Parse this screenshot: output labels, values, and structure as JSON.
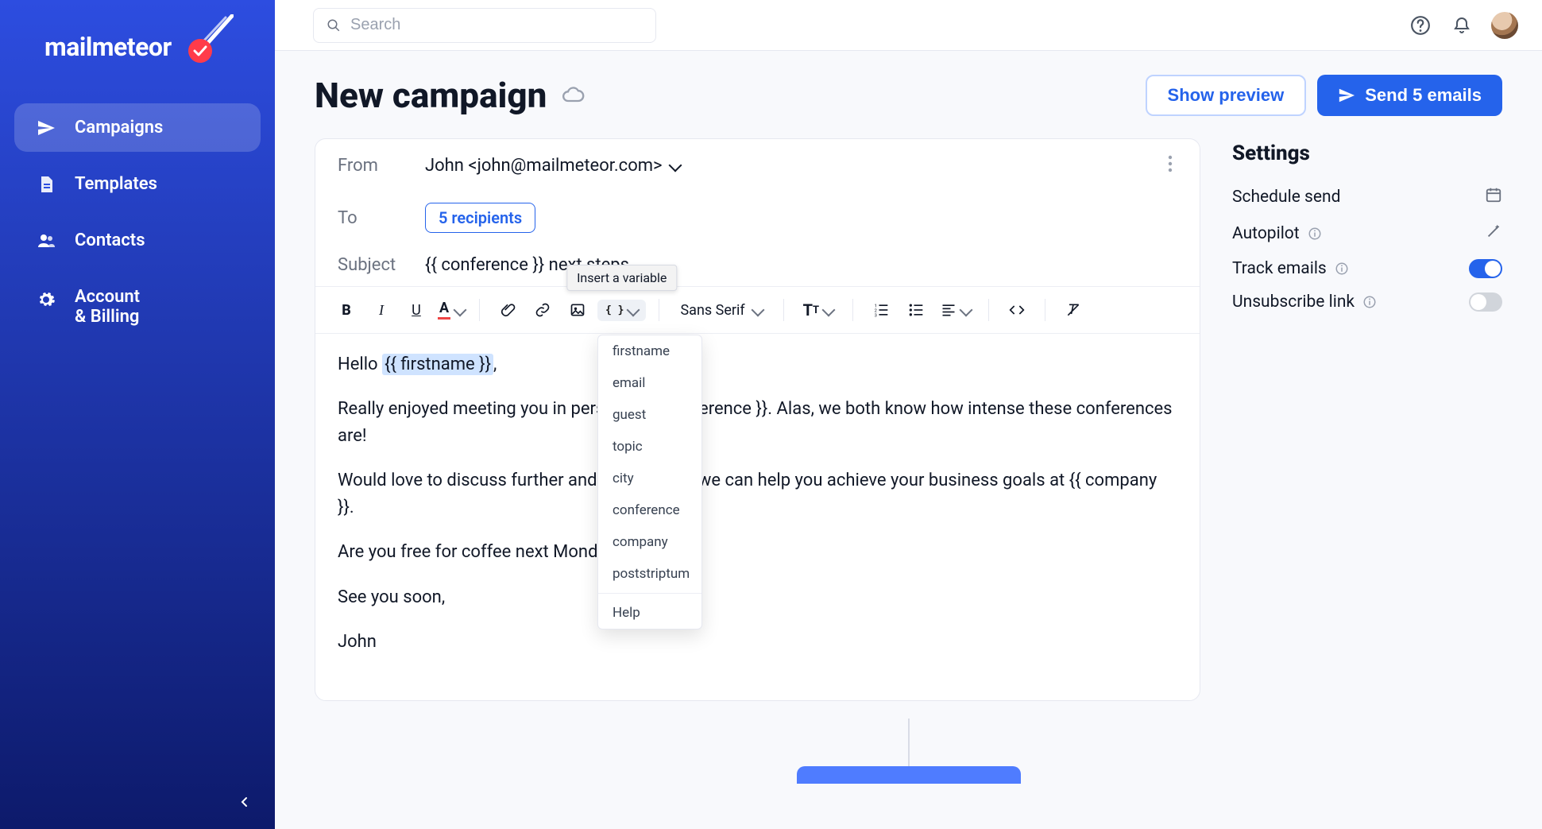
{
  "brand": {
    "name": "mailmeteor"
  },
  "sidebar": {
    "items": [
      {
        "label": "Campaigns",
        "icon": "send-icon",
        "active": true
      },
      {
        "label": "Templates",
        "icon": "file-icon",
        "active": false
      },
      {
        "label": "Contacts",
        "icon": "people-icon",
        "active": false
      },
      {
        "label": "Account & Billing",
        "icon": "gear-icon",
        "active": false
      }
    ]
  },
  "topbar": {
    "search_placeholder": "Search"
  },
  "page": {
    "title": "New campaign",
    "preview_btn": "Show preview",
    "send_btn": "Send 5 emails"
  },
  "compose": {
    "from_label": "From",
    "from_value": "John <john@mailmeteor.com>",
    "to_label": "To",
    "recipients": "5 recipients",
    "subject_label": "Subject",
    "subject_value": "{{ conference }} next steps"
  },
  "toolbar": {
    "font": "Sans Serif",
    "variable_tooltip": "Insert a variable",
    "variable_items": [
      "firstname",
      "email",
      "guest",
      "topic",
      "city",
      "conference",
      "company",
      "poststriptum"
    ],
    "variable_help": "Help"
  },
  "body": {
    "p1_pre": "Hello ",
    "p1_tag": "{{ firstname }}",
    "p1_post": ",",
    "p2": "Really enjoyed meeting you in person at {{ conference }}. Alas, we both know how intense these conferences are!",
    "p3": "Would love to discuss further and explain how we can help you achieve your business goals at {{ company }}.",
    "p4": "Are you free for coffee next Monday?",
    "p5": "See you soon,",
    "p6": "John"
  },
  "settings": {
    "title": "Settings",
    "schedule": "Schedule send",
    "autopilot": "Autopilot",
    "track": "Track emails",
    "unsubscribe": "Unsubscribe link",
    "track_on": true,
    "unsubscribe_on": false
  },
  "colors": {
    "primary": "#2563eb",
    "sidebar_top": "#2d4de0",
    "sidebar_bottom": "#0d1a6b"
  }
}
